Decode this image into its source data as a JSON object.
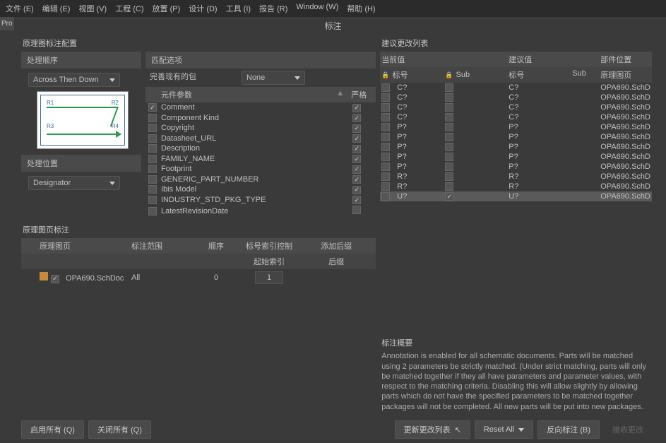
{
  "menu": [
    "文件 (E)",
    "编辑 (E)",
    "视图 (V)",
    "工程 (C)",
    "放置 (P)",
    "设计 (D)",
    "工具 (I)",
    "报告 (R)",
    "Window (W)",
    "帮助 (H)"
  ],
  "sidebar_tab": "Pro",
  "dialog_title": "标注",
  "left": {
    "panel_title": "原理图标注配置",
    "order_header": "处理顺序",
    "order_value": "Across Then Down",
    "position_header": "处理位置",
    "position_value": "Designator",
    "match_header": "匹配选项",
    "complete_label": "完善现有的包",
    "complete_value": "None",
    "param_col": "元件参数",
    "strict_col": "严格",
    "params": [
      {
        "name": "Comment",
        "checked": true,
        "strict": true
      },
      {
        "name": "Component Kind",
        "checked": false,
        "strict": true
      },
      {
        "name": "Copyright",
        "checked": false,
        "strict": true
      },
      {
        "name": "Datasheet_URL",
        "checked": false,
        "strict": true
      },
      {
        "name": "Description",
        "checked": false,
        "strict": true
      },
      {
        "name": "FAMILY_NAME",
        "checked": false,
        "strict": true
      },
      {
        "name": "Footprint",
        "checked": false,
        "strict": true
      },
      {
        "name": "GENERIC_PART_NUMBER",
        "checked": false,
        "strict": true
      },
      {
        "name": "Ibis Model",
        "checked": false,
        "strict": true
      },
      {
        "name": "INDUSTRY_STD_PKG_TYPE",
        "checked": false,
        "strict": true
      },
      {
        "name": "LatestRevisionDate",
        "checked": false,
        "strict": false
      }
    ],
    "sheet_title": "原理图页标注",
    "sheet_cols": {
      "file": "原理图页",
      "range": "标注范围",
      "order": "顺序",
      "idxctrl": "标号索引控制",
      "idx": "起始索引",
      "sufh": "添加后缀",
      "suf": "后缀"
    },
    "sheet_rows": [
      {
        "checked": true,
        "file": "OPA690.SchDoc",
        "range": "All",
        "order": "0",
        "idx": "1"
      }
    ],
    "diag": {
      "r1": "R1",
      "r2": "R2",
      "r3": "R3",
      "r4": "R4"
    }
  },
  "right": {
    "panel_title": "建议更改列表",
    "cols": {
      "current": "当前值",
      "sub": "Sub",
      "proposed": "建议值",
      "sub2": "Sub",
      "loc": "部件位置",
      "des": "标号",
      "page": "原理图页"
    },
    "rows": [
      {
        "cur": "C?",
        "sub": "",
        "pro": "C?",
        "page": "OPA690.SchD"
      },
      {
        "cur": "C?",
        "sub": "",
        "pro": "C?",
        "page": "OPA690.SchD"
      },
      {
        "cur": "C?",
        "sub": "",
        "pro": "C?",
        "page": "OPA690.SchD"
      },
      {
        "cur": "C?",
        "sub": "",
        "pro": "C?",
        "page": "OPA690.SchD"
      },
      {
        "cur": "P?",
        "sub": "",
        "pro": "P?",
        "page": "OPA690.SchD"
      },
      {
        "cur": "P?",
        "sub": "",
        "pro": "P?",
        "page": "OPA690.SchD"
      },
      {
        "cur": "P?",
        "sub": "",
        "pro": "P?",
        "page": "OPA690.SchD"
      },
      {
        "cur": "P?",
        "sub": "",
        "pro": "P?",
        "page": "OPA690.SchD"
      },
      {
        "cur": "P?",
        "sub": "",
        "pro": "P?",
        "page": "OPA690.SchD"
      },
      {
        "cur": "R?",
        "sub": "",
        "pro": "R?",
        "page": "OPA690.SchD"
      },
      {
        "cur": "R?",
        "sub": "",
        "pro": "R?",
        "page": "OPA690.SchD"
      },
      {
        "cur": "U?",
        "sub": "",
        "pro": "U?",
        "page": "OPA690.SchD",
        "hl": true,
        "subchk": true
      }
    ],
    "summary_title": "标注概要",
    "summary_text": "Annotation is enabled for all schematic documents. Parts will be matched using 2 parameters be strictly matched. (Under strict matching, parts will only be matched together if they all have parameters and parameter values, with respect to the matching criteria. Disabling this will allow slightly by allowing parts which do not have the specified parameters to be matched together packages will not be completed. All new parts will be put into new packages."
  },
  "buttons": {
    "enable_all": "启用所有 (Q)",
    "disable_all": "关闭所有 (Q)",
    "update": "更新更改列表",
    "reset": "Reset All",
    "back": "反向标注 (B)",
    "accept": "接收更改"
  }
}
